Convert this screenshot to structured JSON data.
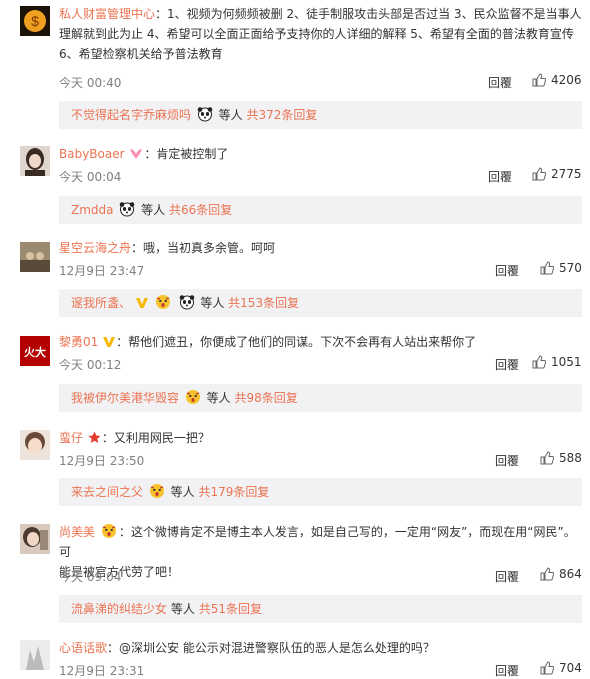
{
  "comments": [
    {
      "user": "私人财富管理中心",
      "text": "1、视频为何频频被删 2、徒手制服攻击头部是否过当 3、民众监督不是当事人理解就到此为止 4、希望可以全面正面给予支持你的人详细的解释 5、希望有全面的普法教育宣传 6、希望检察机关给予普法教育",
      "text_lines": [
        "1、视频为何频频被删 2、徒手制服攻击头部是否过当 3、民众监督不是当事人",
        "理解就到此为止 4、希望可以全面正面给予支持你的人详细的解释 5、希望有全面的普法教育宣传",
        "6、希望检察机关给予普法教育"
      ],
      "time": "今天 00:40",
      "reply_label": "回覆",
      "likes": "4206",
      "sub": {
        "user": "不觉得起名字乔麻烦吗",
        "mid": "等人",
        "more": "共372条回复"
      }
    },
    {
      "user": "BabyBoaer",
      "text": "肯定被控制了",
      "time": "今天 00:04",
      "reply_label": "回覆",
      "likes": "2775",
      "sub": {
        "user": "Zmdda",
        "mid": "等人",
        "more": "共66条回复"
      }
    },
    {
      "user": "星空云海之舟",
      "text": "哦，当初真多余管。呵呵",
      "time": "12月9日 23:47",
      "reply_label": "回覆",
      "likes": "570",
      "sub": {
        "user": "邃我所盞、",
        "mid": "等人",
        "more": "共153条回复"
      }
    },
    {
      "user": "黎勇01",
      "text": "帮他们遮丑，你便成了他们的同谋。下次不会再有人站出来帮你了",
      "time": "今天 00:12",
      "reply_label": "回覆",
      "likes": "1051",
      "sub": {
        "user": "我被伊尔美港华毁容",
        "mid": "等人",
        "more": "共98条回复"
      }
    },
    {
      "user": "蛮仔",
      "text": "又利用网民一把？",
      "time": "12月9日 23:50",
      "reply_label": "回覆",
      "likes": "588",
      "sub": {
        "user": "来去之间之父",
        "mid": "等人",
        "more": "共179条回复"
      }
    },
    {
      "user": "尚美美",
      "text_lines": [
        "这个微博肯定不是博主本人发言，如是自己写的，一定用“网友”，而现在用“网民”。可",
        "能是被官方代劳了吧！"
      ],
      "time": "今天 09:04",
      "reply_label": "回覆",
      "likes": "864",
      "sub": {
        "user": "流鼻涕的纠结少女",
        "mid": "等人",
        "more": "共51条回复"
      }
    },
    {
      "user": "心语话歌",
      "text": "@深圳公安  能公示对混进警察队伍的恶人是怎么处理的吗？",
      "time": "12月9日 23:31",
      "reply_label": "回覆",
      "likes": "704"
    }
  ],
  "colors": {
    "accent": "#eb7350",
    "sub_bg": "#f2f2f5",
    "time": "#808080"
  },
  "icons": [
    "thumb-up-icon",
    "panda-emoji",
    "vip-v-icon",
    "heart-badge-icon",
    "star-badge-icon",
    "shocked-emoji"
  ]
}
